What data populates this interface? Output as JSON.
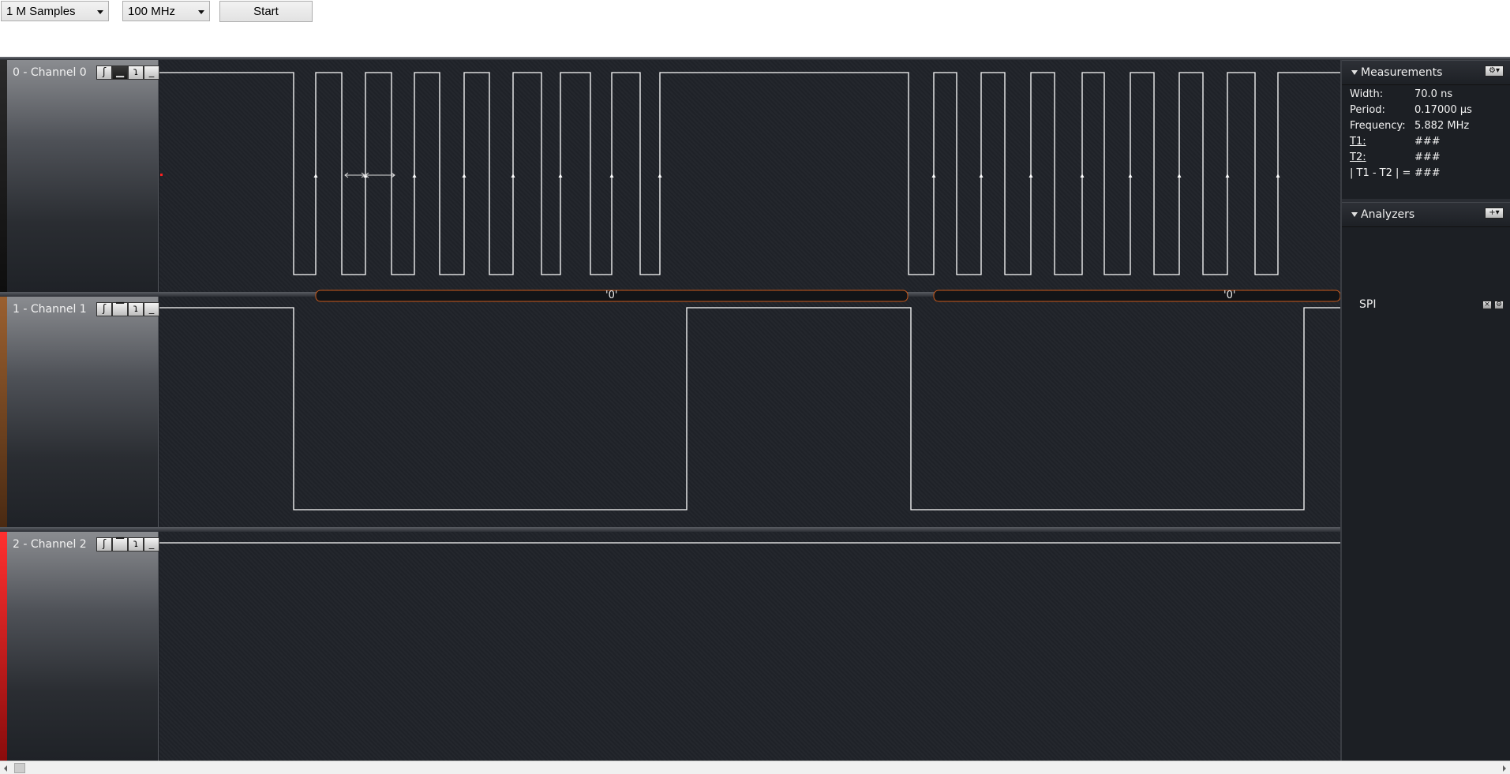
{
  "toolbar": {
    "samples": "1 M Samples",
    "rate": "100 MHz",
    "start_label": "Start"
  },
  "channels": [
    {
      "label": "0 - Channel 0",
      "color": "#1a1a1a"
    },
    {
      "label": "1 - Channel 1",
      "color": "#7a4a24"
    },
    {
      "label": "2 - Channel 2",
      "color": "#e02020"
    }
  ],
  "trigger_icons": [
    "rising-edge-icon",
    "low-level-icon",
    "falling-edge-icon",
    "minimize-icon"
  ],
  "analyzer_bubbles": [
    "'0'",
    "'0'"
  ],
  "measurements": {
    "title": "Measurements",
    "rows": [
      {
        "key": "Width:",
        "value": "70.0 ns"
      },
      {
        "key": "Period:",
        "value": "0.17000 µs"
      },
      {
        "key": "Frequency:",
        "value": "5.882 MHz"
      },
      {
        "key": "T1:",
        "value": "###"
      },
      {
        "key": "T2:",
        "value": "###"
      },
      {
        "key": "| T1 - T2 | =",
        "value": "###"
      }
    ]
  },
  "analyzers": {
    "title": "Analyzers",
    "items": [
      {
        "name": "SPI"
      }
    ]
  },
  "colors": {
    "background": "#1f2228",
    "trace": "#ffffff",
    "bubble_border": "#c8581a"
  }
}
